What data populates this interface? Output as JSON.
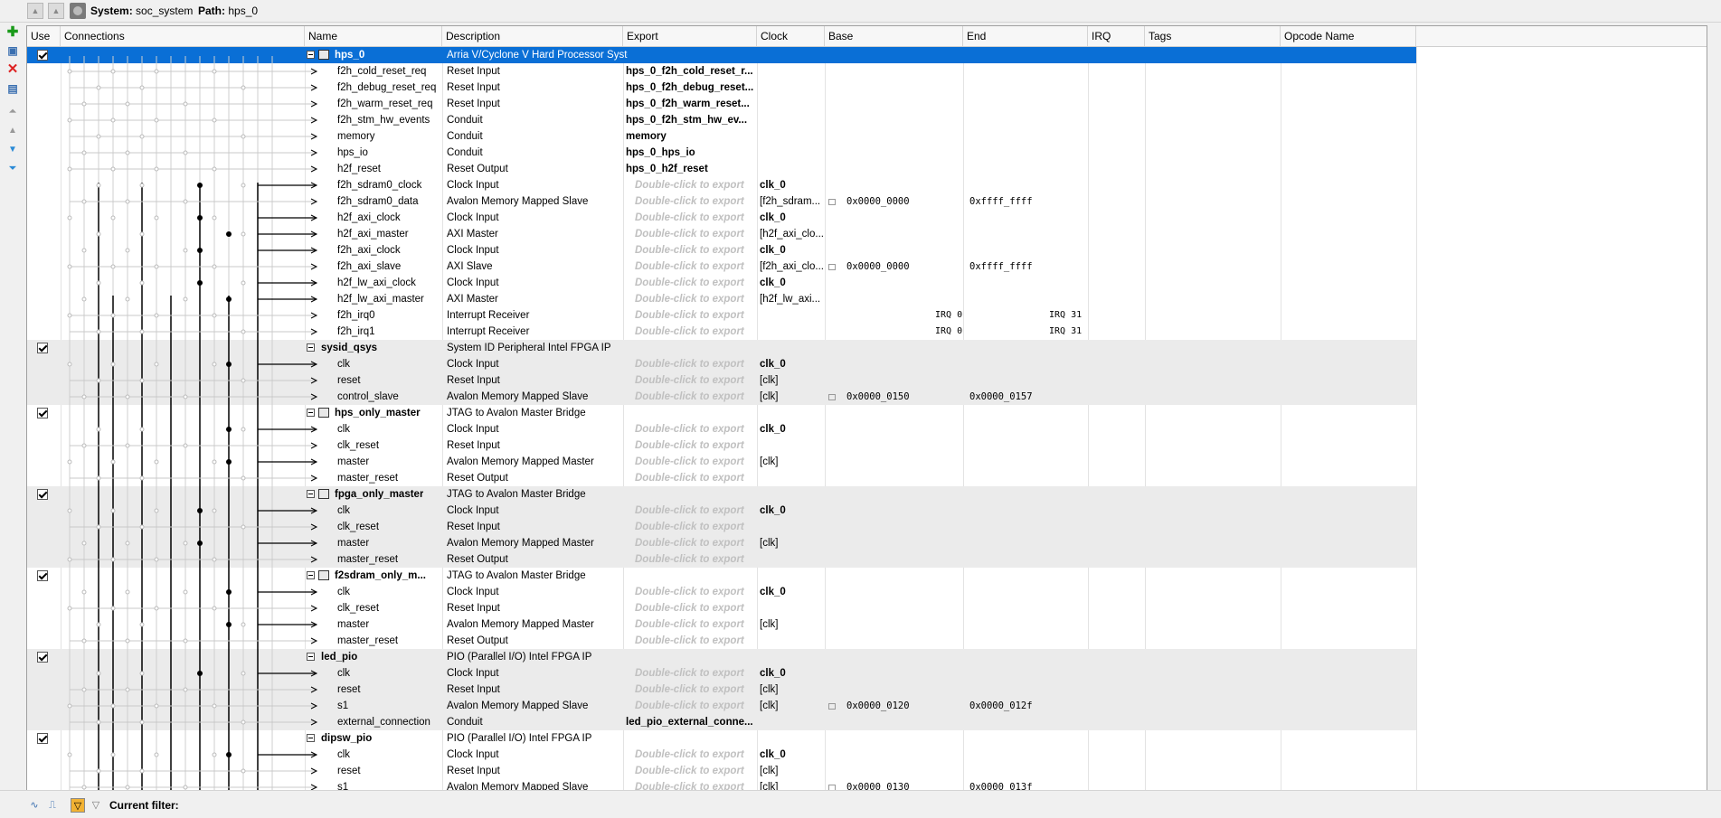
{
  "topbar": {
    "system_label": "System:",
    "system_value": "soc_system",
    "path_label": "Path:",
    "path_value": "hps_0"
  },
  "columns": [
    "Use",
    "Connections",
    "Name",
    "Description",
    "Export",
    "Clock",
    "Base",
    "End",
    "IRQ",
    "Tags",
    "Opcode Name"
  ],
  "rows": [
    {
      "type": "comp",
      "use": true,
      "name": "hps_0",
      "desc": "Arria V/Cyclone V Hard Processor System",
      "export": "",
      "clock": "",
      "base": "",
      "end": "",
      "selected": true
    },
    {
      "name": "f2h_cold_reset_req",
      "desc": "Reset Input",
      "export": "hps_0_f2h_cold_reset_r...",
      "exportBold": true
    },
    {
      "name": "f2h_debug_reset_req",
      "desc": "Reset Input",
      "export": "hps_0_f2h_debug_reset...",
      "exportBold": true
    },
    {
      "name": "f2h_warm_reset_req",
      "desc": "Reset Input",
      "export": "hps_0_f2h_warm_reset...",
      "exportBold": true
    },
    {
      "name": "f2h_stm_hw_events",
      "desc": "Conduit",
      "export": "hps_0_f2h_stm_hw_ev...",
      "exportBold": true
    },
    {
      "name": "memory",
      "desc": "Conduit",
      "export": "memory",
      "exportBold": true
    },
    {
      "name": "hps_io",
      "desc": "Conduit",
      "export": "hps_0_hps_io",
      "exportBold": true
    },
    {
      "name": "h2f_reset",
      "desc": "Reset Output",
      "export": "hps_0_h2f_reset",
      "exportBold": true
    },
    {
      "name": "f2h_sdram0_clock",
      "desc": "Clock Input",
      "export": "Double-click to export",
      "clock": "clk_0",
      "clockBold": true
    },
    {
      "name": "f2h_sdram0_data",
      "desc": "Avalon Memory Mapped Slave",
      "export": "Double-click to export",
      "clock": "[f2h_sdram...",
      "base": "0x0000_0000",
      "end": "0xffff_ffff"
    },
    {
      "name": "h2f_axi_clock",
      "desc": "Clock Input",
      "export": "Double-click to export",
      "clock": "clk_0",
      "clockBold": true
    },
    {
      "name": "h2f_axi_master",
      "desc": "AXI Master",
      "export": "Double-click to export",
      "clock": "[h2f_axi_clo..."
    },
    {
      "name": "f2h_axi_clock",
      "desc": "Clock Input",
      "export": "Double-click to export",
      "clock": "clk_0",
      "clockBold": true
    },
    {
      "name": "f2h_axi_slave",
      "desc": "AXI Slave",
      "export": "Double-click to export",
      "clock": "[f2h_axi_clo...",
      "base": "0x0000_0000",
      "end": "0xffff_ffff"
    },
    {
      "name": "h2f_lw_axi_clock",
      "desc": "Clock Input",
      "export": "Double-click to export",
      "clock": "clk_0",
      "clockBold": true
    },
    {
      "name": "h2f_lw_axi_master",
      "desc": "AXI Master",
      "export": "Double-click to export",
      "clock": "[h2f_lw_axi..."
    },
    {
      "name": "f2h_irq0",
      "desc": "Interrupt Receiver",
      "export": "Double-click to export",
      "irq": "IRQ 0",
      "irqEnd": "IRQ 31"
    },
    {
      "name": "f2h_irq1",
      "desc": "Interrupt Receiver",
      "export": "Double-click to export",
      "irq": "IRQ 0",
      "irqEnd": "IRQ 31"
    },
    {
      "type": "comp",
      "use": true,
      "name": "sysid_qsys",
      "desc": "System ID Peripheral Intel FPGA IP",
      "noicon": true
    },
    {
      "name": "clk",
      "desc": "Clock Input",
      "export": "Double-click to export",
      "clock": "clk_0",
      "clockBold": true
    },
    {
      "name": "reset",
      "desc": "Reset Input",
      "export": "Double-click to export",
      "clock": "[clk]"
    },
    {
      "name": "control_slave",
      "desc": "Avalon Memory Mapped Slave",
      "export": "Double-click to export",
      "clock": "[clk]",
      "base": "0x0000_0150",
      "end": "0x0000_0157"
    },
    {
      "type": "comp",
      "use": true,
      "name": "hps_only_master",
      "desc": "JTAG to Avalon Master Bridge"
    },
    {
      "name": "clk",
      "desc": "Clock Input",
      "export": "Double-click to export",
      "clock": "clk_0",
      "clockBold": true
    },
    {
      "name": "clk_reset",
      "desc": "Reset Input",
      "export": "Double-click to export"
    },
    {
      "name": "master",
      "desc": "Avalon Memory Mapped Master",
      "export": "Double-click to export",
      "clock": "[clk]"
    },
    {
      "name": "master_reset",
      "desc": "Reset Output",
      "export": "Double-click to export"
    },
    {
      "type": "comp",
      "use": true,
      "name": "fpga_only_master",
      "desc": "JTAG to Avalon Master Bridge"
    },
    {
      "name": "clk",
      "desc": "Clock Input",
      "export": "Double-click to export",
      "clock": "clk_0",
      "clockBold": true
    },
    {
      "name": "clk_reset",
      "desc": "Reset Input",
      "export": "Double-click to export"
    },
    {
      "name": "master",
      "desc": "Avalon Memory Mapped Master",
      "export": "Double-click to export",
      "clock": "[clk]"
    },
    {
      "name": "master_reset",
      "desc": "Reset Output",
      "export": "Double-click to export"
    },
    {
      "type": "comp",
      "use": true,
      "name": "f2sdram_only_m...",
      "desc": "JTAG to Avalon Master Bridge"
    },
    {
      "name": "clk",
      "desc": "Clock Input",
      "export": "Double-click to export",
      "clock": "clk_0",
      "clockBold": true
    },
    {
      "name": "clk_reset",
      "desc": "Reset Input",
      "export": "Double-click to export"
    },
    {
      "name": "master",
      "desc": "Avalon Memory Mapped Master",
      "export": "Double-click to export",
      "clock": "[clk]"
    },
    {
      "name": "master_reset",
      "desc": "Reset Output",
      "export": "Double-click to export"
    },
    {
      "type": "comp",
      "use": true,
      "name": "led_pio",
      "desc": "PIO (Parallel I/O) Intel FPGA IP",
      "noicon": true
    },
    {
      "name": "clk",
      "desc": "Clock Input",
      "export": "Double-click to export",
      "clock": "clk_0",
      "clockBold": true
    },
    {
      "name": "reset",
      "desc": "Reset Input",
      "export": "Double-click to export",
      "clock": "[clk]"
    },
    {
      "name": "s1",
      "desc": "Avalon Memory Mapped Slave",
      "export": "Double-click to export",
      "clock": "[clk]",
      "base": "0x0000_0120",
      "end": "0x0000_012f"
    },
    {
      "name": "external_connection",
      "desc": "Conduit",
      "export": "led_pio_external_conne...",
      "exportBold": true
    },
    {
      "type": "comp",
      "use": true,
      "name": "dipsw_pio",
      "desc": "PIO (Parallel I/O) Intel FPGA IP",
      "noicon": true
    },
    {
      "name": "clk",
      "desc": "Clock Input",
      "export": "Double-click to export",
      "clock": "clk_0",
      "clockBold": true
    },
    {
      "name": "reset",
      "desc": "Reset Input",
      "export": "Double-click to export",
      "clock": "[clk]"
    },
    {
      "name": "s1",
      "desc": "Avalon Memory Mapped Slave",
      "export": "Double-click to export",
      "clock": "[clk]",
      "base": "0x0000_0130",
      "end": "0x0000_013f"
    }
  ],
  "footer": {
    "filter_label": "Current filter:"
  },
  "icons": {
    "add": "plus-icon",
    "remove": "x-icon",
    "move_top": "move-top-icon",
    "move_up": "move-up-icon",
    "move_down": "move-down-icon",
    "move_bottom": "move-bottom-icon"
  },
  "colors": {
    "selection": "#0a6fd6",
    "alt_row": "#ebebeb",
    "placeholder": "#c0c0c0"
  }
}
